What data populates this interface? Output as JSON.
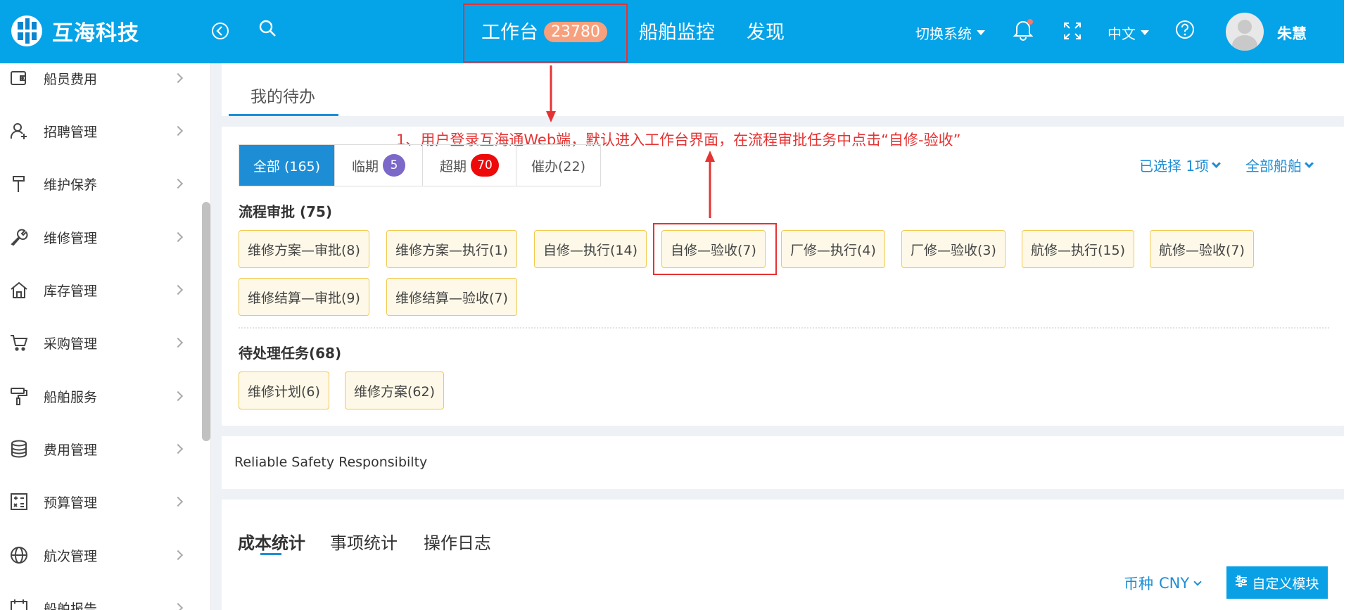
{
  "header": {
    "brand": "互海科技",
    "nav": [
      {
        "label": "工作台",
        "badge": "23780"
      },
      {
        "label": "船舶监控"
      },
      {
        "label": "发现"
      }
    ],
    "switch_system": "切换系统",
    "language": "中文",
    "username": "朱慧"
  },
  "sidebar": {
    "items": [
      {
        "label": "船员费用",
        "icon": "wallet-icon"
      },
      {
        "label": "招聘管理",
        "icon": "user-add-icon"
      },
      {
        "label": "维护保养",
        "icon": "hammer-icon"
      },
      {
        "label": "维修管理",
        "icon": "wrench-icon"
      },
      {
        "label": "库存管理",
        "icon": "home-icon"
      },
      {
        "label": "采购管理",
        "icon": "cart-icon"
      },
      {
        "label": "船舶服务",
        "icon": "paint-roller-icon"
      },
      {
        "label": "费用管理",
        "icon": "database-icon"
      },
      {
        "label": "预算管理",
        "icon": "calculator-icon"
      },
      {
        "label": "航次管理",
        "icon": "globe-icon"
      },
      {
        "label": "船舶报告",
        "icon": "calendar-icon"
      }
    ]
  },
  "todo": {
    "tab": "我的待办",
    "segments": [
      {
        "label": "全部 (165)"
      },
      {
        "label": "临期",
        "badge": "5",
        "color": "#7b68c8"
      },
      {
        "label": "超期",
        "badge": "70",
        "color": "#ee0a0a"
      },
      {
        "label": "催办(22)"
      }
    ],
    "annotation": "1、用户登录互海通Web端，默认进入工作台界面，在流程审批任务中点击“自修-验收”",
    "filter_selected": "已选择 1项",
    "filter_ships": "全部船舶",
    "approval_title": "流程审批 (75)",
    "approval_tags": [
      "维修方案—审批(8)",
      "维修方案—执行(1)",
      "自修—执行(14)",
      "自修—验收(7)",
      "厂修—执行(4)",
      "厂修—验收(3)",
      "航修—执行(15)",
      "航修—验收(7)",
      "维修结算—审批(9)",
      "维修结算—验收(7)"
    ],
    "pending_title": "待处理任务(68)",
    "pending_tags": [
      "维修计划(6)",
      "维修方案(62)"
    ]
  },
  "slogan": "Reliable Safety Responsibilty",
  "stats": {
    "tabs": [
      "成本统计",
      "事项统计",
      "操作日志"
    ],
    "currency_label": "币种",
    "currency_value": "CNY",
    "custom_button": "自定义模块"
  },
  "colors": {
    "header_bg": "#05a3e8",
    "accent": "#1d8ed6",
    "annotation": "#e53333",
    "tag_bg": "#fdf8e8",
    "tag_border": "#f2c94c"
  }
}
